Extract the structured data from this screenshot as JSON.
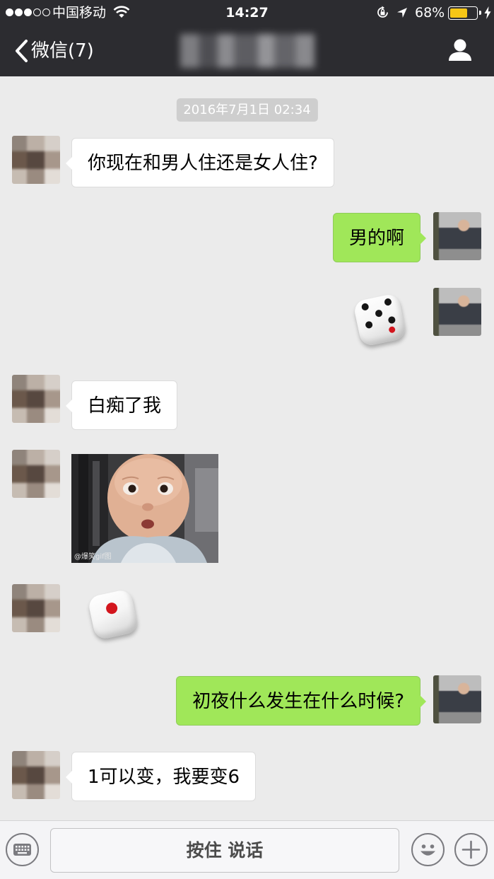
{
  "status_bar": {
    "signal_strength": 3,
    "signal_max": 5,
    "carrier": "中国移动",
    "time": "14:27",
    "battery_percent": "68%",
    "battery_level": 0.68
  },
  "nav_bar": {
    "back_label": "微信(7)"
  },
  "chat": {
    "timestamp": "2016年7月1日 02:34",
    "messages": [
      {
        "text": "你现在和男人住还是女人住?"
      },
      {
        "text": "男的啊"
      },
      {
        "dice": 5
      },
      {
        "text": "白痴了我"
      },
      {
        "image_watermark": "@爆笑gif图"
      },
      {
        "dice": 1
      },
      {
        "text": "初夜什么发生在什么时候?"
      },
      {
        "text": "1可以变，我要变6"
      }
    ]
  },
  "input_bar": {
    "voice_button_label": "按住 说话"
  },
  "icons": {
    "signal": "signal-strength-icon",
    "wifi": "wifi-icon",
    "orientation_lock": "orientation-lock-icon",
    "location": "location-arrow-icon",
    "battery": "battery-icon",
    "charging": "charging-bolt-icon",
    "back": "back-chevron-icon",
    "contact": "contact-info-icon",
    "keyboard": "keyboard-icon",
    "emoji": "emoji-icon",
    "more": "plus-icon"
  },
  "colors": {
    "nav_bar": "#2c2c30",
    "chat_background": "#ebebeb",
    "sent_bubble": "#a0e759",
    "received_bubble": "#ffffff",
    "timestamp_pill": "#cecece",
    "battery_fill": "#f6c616"
  }
}
